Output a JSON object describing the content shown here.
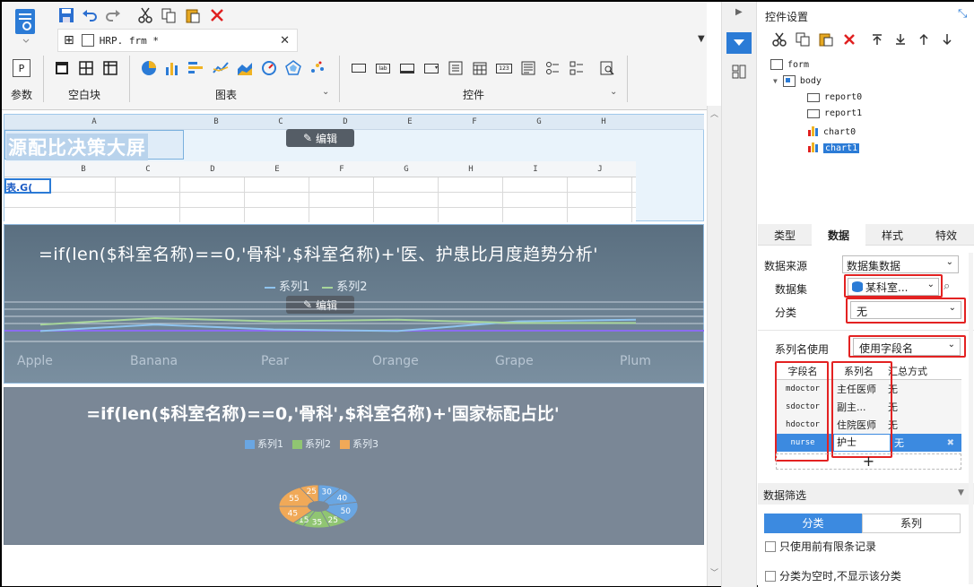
{
  "file_tab": {
    "name": "HRP. frm *"
  },
  "ribbon": {
    "groups": [
      {
        "label": "参数"
      },
      {
        "label": "空白块"
      },
      {
        "label": "图表"
      },
      {
        "label": "控件"
      }
    ]
  },
  "canvas": {
    "sheet_cols": [
      "A",
      "B",
      "C",
      "D",
      "E",
      "F",
      "G",
      "H"
    ],
    "body_cols": [
      "B",
      "C",
      "D",
      "E",
      "F",
      "G",
      "H",
      "I",
      "J"
    ],
    "title_text": "源配比决策大屏",
    "cell_formula": "表.G(",
    "edit_label": "编辑",
    "chart1": {
      "title": "=if(len($科室名称)==0,'骨科',$科室名称)+'医、护患比月度趋势分析'",
      "legend": [
        "系列1",
        "系列2"
      ],
      "x_labels": [
        "Apple",
        "Banana",
        "Pear",
        "Orange",
        "Grape",
        "Plum"
      ]
    },
    "chart2": {
      "title": "=if(len($科室名称)==0,'骨科',$科室名称)+'国家标配占比'",
      "legend": [
        "系列1",
        "系列2",
        "系列3"
      ]
    }
  },
  "chart_data": [
    {
      "type": "line",
      "title": "=if(len($科室名称)==0,'骨科',$科室名称)+'医、护患比月度趋势分析'",
      "categories": [
        "Apple",
        "Banana",
        "Pear",
        "Orange",
        "Grape",
        "Plum"
      ],
      "series": [
        {
          "name": "系列1",
          "values": [
            1,
            3,
            1.5,
            1,
            4,
            4.5
          ]
        },
        {
          "name": "系列2",
          "values": [
            3,
            5,
            4,
            4.5,
            3.5,
            3.5
          ]
        }
      ]
    },
    {
      "type": "pie",
      "title": "=if(len($科室名称)==0,'骨科',$科室名称)+'国家标配占比'",
      "series": [
        {
          "name": "系列1",
          "values": [
            30,
            40,
            50
          ]
        },
        {
          "name": "系列2",
          "values": [
            25,
            35,
            15
          ]
        },
        {
          "name": "系列3",
          "values": [
            45,
            55,
            25
          ]
        }
      ]
    }
  ],
  "right_panel": {
    "title": "控件设置",
    "tree": [
      "form",
      "body",
      "report0",
      "report1",
      "chart0",
      "chart1"
    ],
    "tabs": [
      "类型",
      "数据",
      "样式",
      "特效"
    ],
    "data_source_label": "数据来源",
    "data_source_value": "数据集数据",
    "dataset_label": "数据集",
    "dataset_value": "某科室...",
    "category_label": "分类",
    "category_value": "无",
    "series_name_label": "系列名使用",
    "series_name_value": "使用字段名",
    "table_headers": [
      "字段名",
      "系列名",
      "汇总方式"
    ],
    "rows": [
      {
        "field": "mdoctor",
        "series": "主任医师",
        "agg": "无"
      },
      {
        "field": "sdoctor",
        "series": "副主...",
        "agg": "无"
      },
      {
        "field": "hdoctor",
        "series": "住院医师",
        "agg": "无"
      },
      {
        "field": "nurse",
        "series": "护士",
        "agg": "无"
      }
    ],
    "add_label": "+",
    "filter_title": "数据筛选",
    "filter_tabs": [
      "分类",
      "系列"
    ],
    "opt_limit": "只使用前有限条记录",
    "opt_empty": "分类为空时,不显示该分类"
  }
}
